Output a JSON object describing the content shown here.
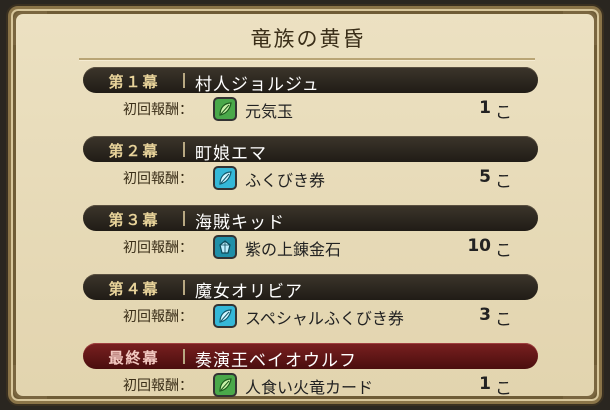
{
  "title": "竜族の黄昏",
  "colors": {
    "panel": "#e6d9b6",
    "chapter_bar": "#2a241c",
    "final_bar": "#5e1414",
    "icon_green": "#4aa84a",
    "icon_cyan": "#35b8d8",
    "icon_teal": "#1f8fa8"
  },
  "chapters": [
    {
      "label": "第１幕",
      "boss": "村人ジョルジュ",
      "reward_label": "初回報酬：",
      "icon": "green-leaf-icon",
      "item": "元気玉",
      "qty": "1",
      "unit": "こ"
    },
    {
      "label": "第２幕",
      "boss": "町娘エマ",
      "reward_label": "初回報酬：",
      "icon": "cyan-leaf-icon",
      "item": "ふくびき券",
      "qty": "5",
      "unit": "こ"
    },
    {
      "label": "第３幕",
      "boss": "海賊キッド",
      "reward_label": "初回報酬：",
      "icon": "gem-icon",
      "item": "紫の上錬金石",
      "qty": "10",
      "unit": "こ"
    },
    {
      "label": "第４幕",
      "boss": "魔女オリビア",
      "reward_label": "初回報酬：",
      "icon": "cyan-leaf-icon",
      "item": "スペシャルふくびき券",
      "qty": "3",
      "unit": "こ"
    },
    {
      "label": "最終幕",
      "boss": "奏演王ベイオウルフ",
      "reward_label": "初回報酬：",
      "icon": "green-leaf-icon",
      "item": "人食い火竜カード",
      "qty": "1",
      "unit": "こ"
    }
  ]
}
